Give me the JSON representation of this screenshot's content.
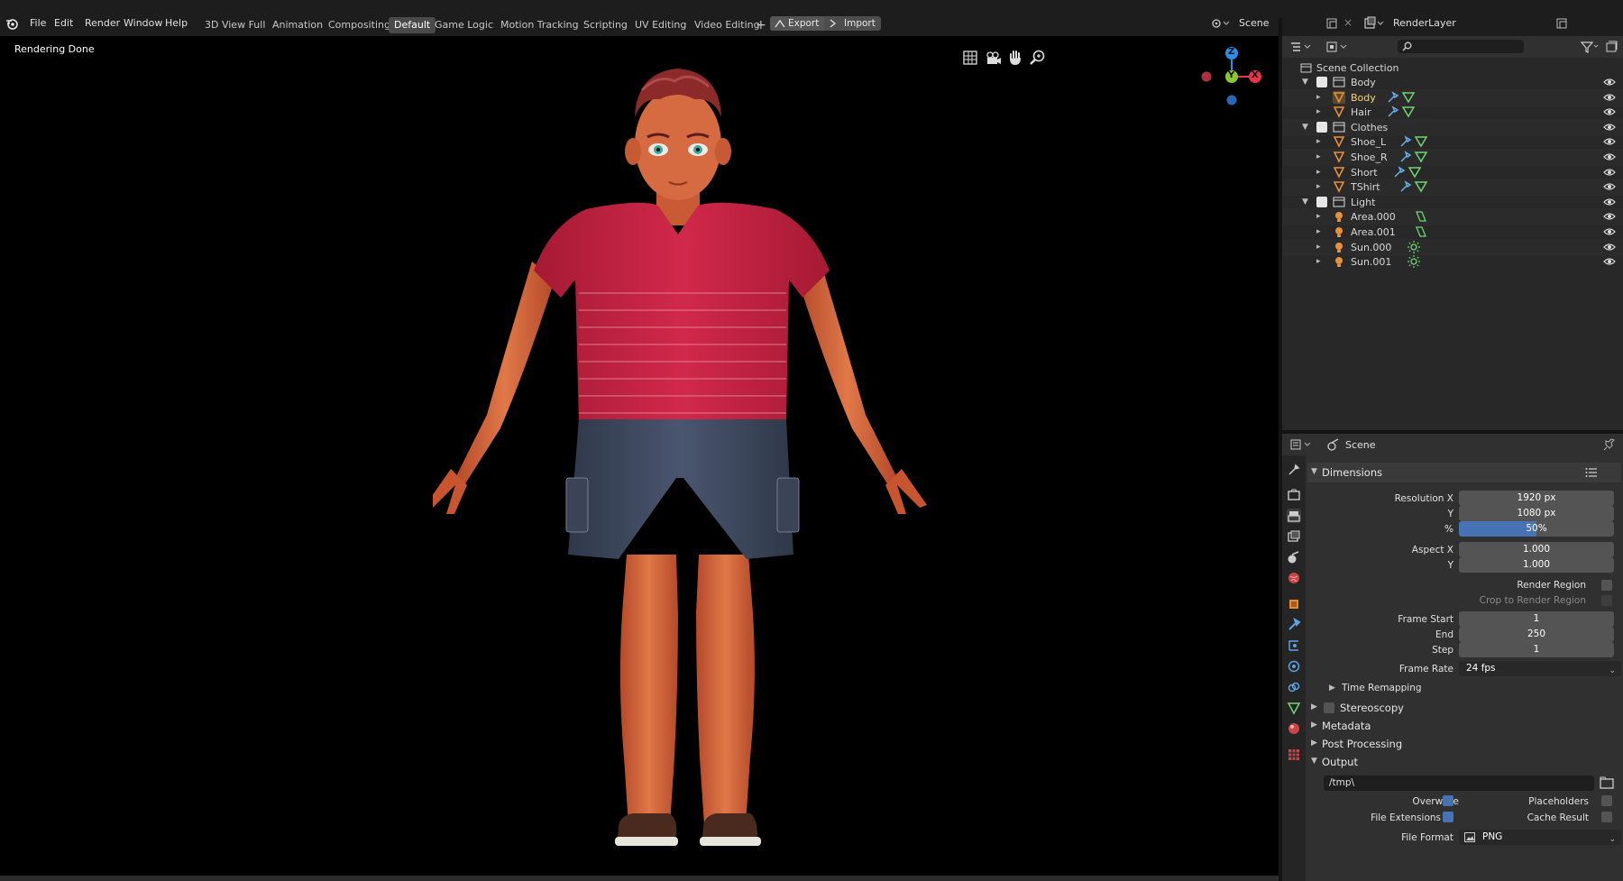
{
  "menubar": {
    "items": [
      "File",
      "Edit",
      "Render",
      "Window",
      "Help"
    ]
  },
  "workspaces": {
    "tabs": [
      "3D View Full",
      "Animation",
      "Compositing",
      "Default",
      "Game Logic",
      "Motion Tracking",
      "Scripting",
      "UV Editing",
      "Video Editing"
    ],
    "active": "Default",
    "add_label": "+",
    "export_label": "Export",
    "import_label": "Import"
  },
  "scene_selector": {
    "scene": "Scene",
    "render_layer": "RenderLayer"
  },
  "viewport": {
    "status": "Rendering Done",
    "gizmo": {
      "z": "Z",
      "y": "Y",
      "x": "X"
    },
    "tools": [
      "grid-icon",
      "camera-icon",
      "hand-icon",
      "zoom-icon"
    ]
  },
  "outliner": {
    "search_placeholder": "",
    "root": "Scene Collection",
    "rows": [
      {
        "label": "Body",
        "kind": "collection",
        "level": 0
      },
      {
        "label": "Body",
        "kind": "mesh",
        "level": 1,
        "highlight": true
      },
      {
        "label": "Hair",
        "kind": "mesh",
        "level": 1
      },
      {
        "label": "Clothes",
        "kind": "collection",
        "level": 0
      },
      {
        "label": "Shoe_L",
        "kind": "mesh",
        "level": 1
      },
      {
        "label": "Shoe_R",
        "kind": "mesh",
        "level": 1
      },
      {
        "label": "Short",
        "kind": "mesh",
        "level": 1
      },
      {
        "label": "TShirt",
        "kind": "mesh",
        "level": 1
      },
      {
        "label": "Light",
        "kind": "collection",
        "level": 0
      },
      {
        "label": "Area.000",
        "kind": "light-area",
        "level": 1
      },
      {
        "label": "Area.001",
        "kind": "light-area",
        "level": 1
      },
      {
        "label": "Sun.000",
        "kind": "light-sun",
        "level": 1
      },
      {
        "label": "Sun.001",
        "kind": "light-sun",
        "level": 1
      }
    ]
  },
  "properties": {
    "context": "Scene",
    "dimensions": {
      "title": "Dimensions",
      "resolution_x_label": "Resolution X",
      "resolution_x": "1920 px",
      "resolution_y_label": "Y",
      "resolution_y": "1080 px",
      "percent_label": "%",
      "percent": "50%",
      "percent_fraction": 0.5,
      "aspect_x_label": "Aspect X",
      "aspect_x": "1.000",
      "aspect_y_label": "Y",
      "aspect_y": "1.000",
      "render_region_label": "Render Region",
      "crop_label": "Crop to Render Region",
      "frame_start_label": "Frame Start",
      "frame_start": "1",
      "frame_end_label": "End",
      "frame_end": "250",
      "frame_step_label": "Step",
      "frame_step": "1",
      "frame_rate_label": "Frame Rate",
      "frame_rate": "24 fps",
      "time_remapping": "Time Remapping"
    },
    "panels": {
      "stereoscopy": "Stereoscopy",
      "metadata": "Metadata",
      "post_processing": "Post Processing",
      "output": "Output"
    },
    "output": {
      "path": "/tmp\\",
      "overwrite": "Overwrite",
      "placeholders": "Placeholders",
      "file_extensions": "File Extensions",
      "cache_result": "Cache Result",
      "file_format_label": "File Format",
      "file_format": "PNG"
    }
  },
  "colors": {
    "accent": "#4772b3",
    "shirt": "#c8203e",
    "skin": "#d9663d",
    "shorts": "#3c4659",
    "hair": "#8c2a2a",
    "axis_x": "#e8334b",
    "axis_y": "#8ac631",
    "axis_z": "#2d8ce6"
  }
}
